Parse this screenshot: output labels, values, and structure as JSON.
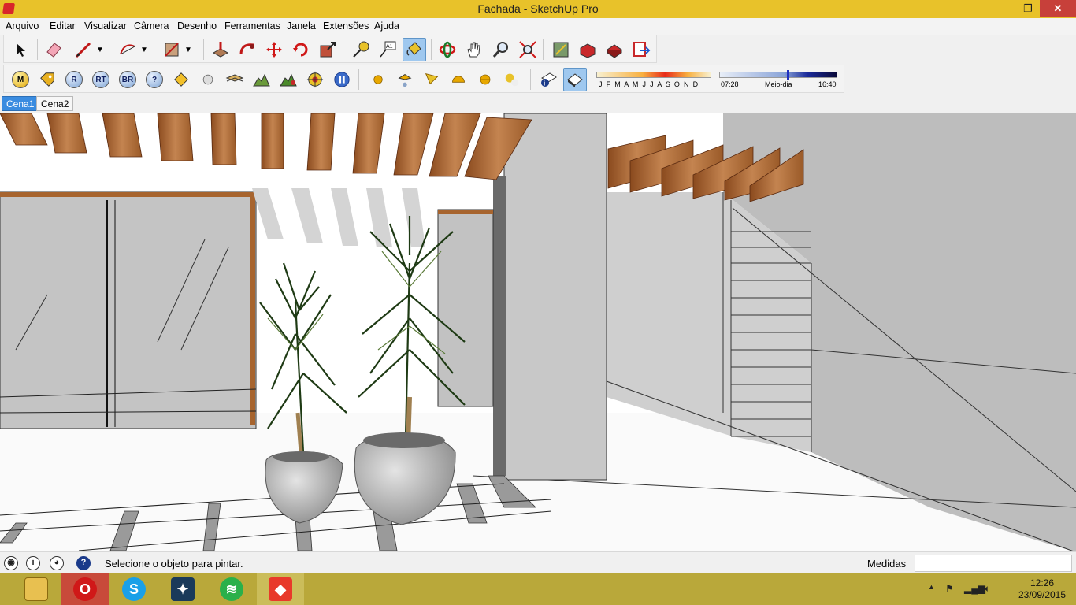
{
  "window": {
    "title": "Fachada - SketchUp Pro",
    "minimize_glyph": "—",
    "restore_glyph": "❐",
    "close_glyph": "✕"
  },
  "menu": [
    "Arquivo",
    "Editar",
    "Visualizar",
    "Câmera",
    "Desenho",
    "Ferramentas",
    "Janela",
    "Extensões",
    "Ajuda"
  ],
  "toolbar_row2_labels": {
    "m": "M",
    "r": "R",
    "rt": "RT",
    "br": "BR",
    "help": "?",
    "months": "J F M A M J J A S O N D",
    "time_start": "07:28",
    "time_mid": "Meio-dia",
    "time_end": "16:40"
  },
  "scenes": [
    "Cena1",
    "Cena2"
  ],
  "status": {
    "hint": "Selecione o objeto para pintar.",
    "measurements_label": "Medidas",
    "measurements_value": ""
  },
  "taskbar": {
    "tray_arrow": "▲",
    "time": "12:26",
    "date": "23/09/2015"
  },
  "icons": {
    "toolbar1": [
      "select-icon",
      "eraser-icon",
      "pencil-icon",
      "arc-icon",
      "rectangle-icon",
      "push-pull-icon",
      "follow-me-icon",
      "move-icon",
      "rotate-icon",
      "scale-icon",
      "tape-measure-icon",
      "text-icon",
      "paint-bucket-icon",
      "orbit-icon",
      "pan-icon",
      "zoom-icon",
      "zoom-extents-icon",
      "warehouse-icon",
      "share-model-icon",
      "extension-warehouse-icon",
      "send-to-layout-icon"
    ],
    "toolbar2": [
      "m-icon",
      "tag-icon",
      "r-icon",
      "rt-icon",
      "br-icon",
      "help-icon",
      "label-icon",
      "sphere-icon",
      "planes-icon",
      "terrain-icon",
      "terrain2-icon",
      "target-icon",
      "pause-icon",
      "sun-icon",
      "lamp-icon",
      "spot-icon",
      "half-sun-icon",
      "sphere-light-icon",
      "moon-icon",
      "info-shadow-icon",
      "shadow-toggle-icon"
    ]
  },
  "colors": {
    "titlebar": "#e8c22a",
    "close": "#c7403a",
    "active_tab": "#3a8ce0",
    "taskbar": "#b9a83a",
    "wood": "#a7642e"
  }
}
